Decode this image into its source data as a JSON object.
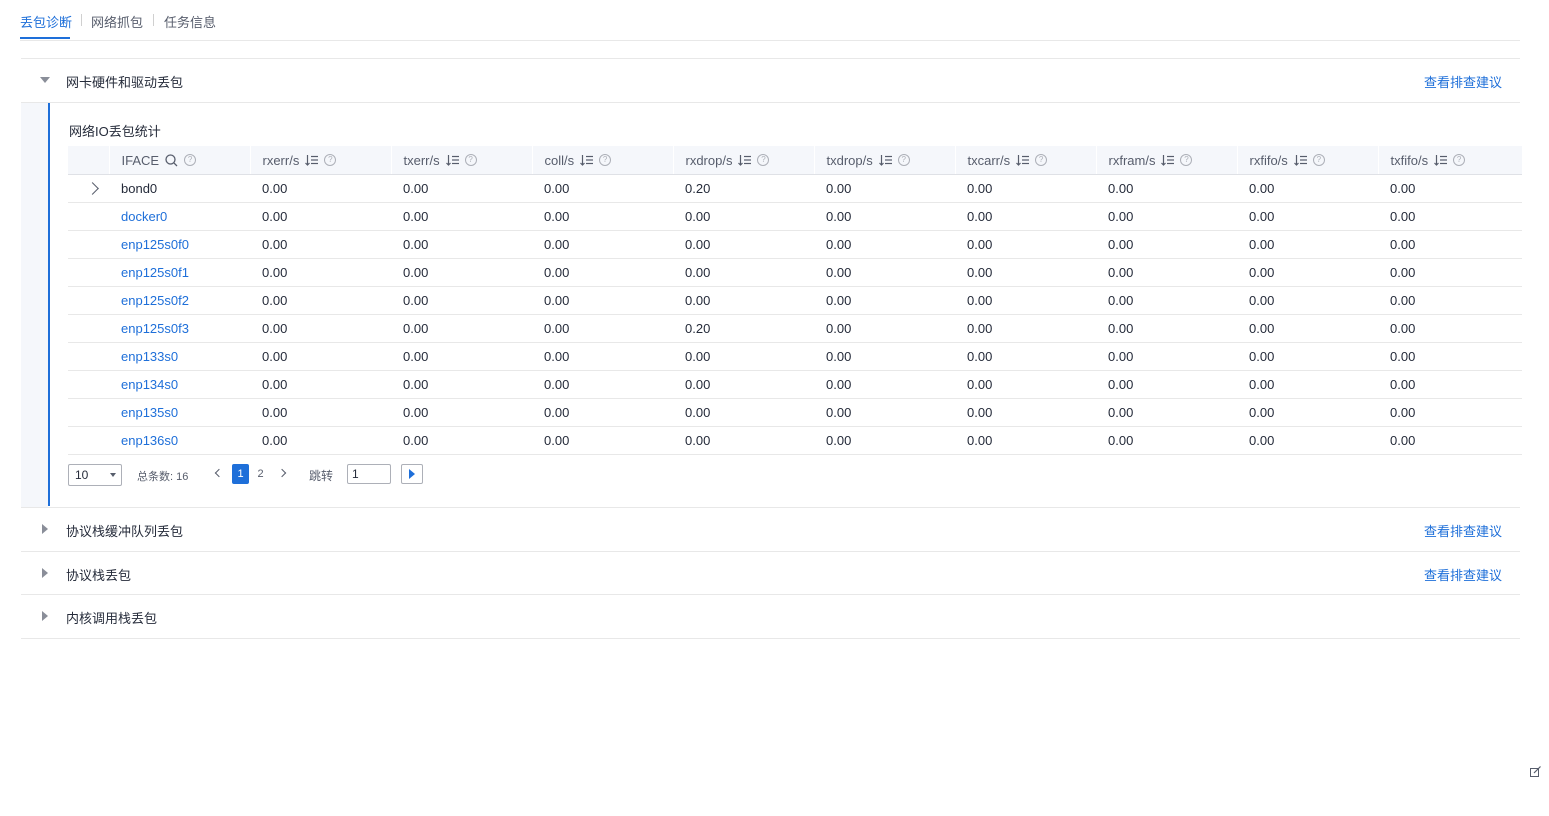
{
  "tabs": [
    {
      "label": "丢包诊断",
      "active": true
    },
    {
      "label": "网络抓包",
      "active": false
    },
    {
      "label": "任务信息",
      "active": false
    }
  ],
  "sections": [
    {
      "title": "网卡硬件和驱动丢包",
      "advice": "查看排查建议",
      "expanded": true
    },
    {
      "title": "协议栈缓冲队列丢包",
      "advice": "查看排查建议",
      "expanded": false
    },
    {
      "title": "协议栈丢包",
      "advice": "查看排查建议",
      "expanded": false
    },
    {
      "title": "内核调用栈丢包",
      "advice": "",
      "expanded": false
    }
  ],
  "table": {
    "title": "网络IO丢包统计",
    "columns": [
      "IFACE",
      "rxerr/s",
      "txerr/s",
      "coll/s",
      "rxdrop/s",
      "txdrop/s",
      "txcarr/s",
      "rxfram/s",
      "rxfifo/s",
      "txfifo/s"
    ],
    "rows": [
      {
        "iface": "bond0",
        "expandable": true,
        "values": [
          "0.00",
          "0.00",
          "0.00",
          "0.20",
          "0.00",
          "0.00",
          "0.00",
          "0.00",
          "0.00"
        ]
      },
      {
        "iface": "docker0",
        "values": [
          "0.00",
          "0.00",
          "0.00",
          "0.00",
          "0.00",
          "0.00",
          "0.00",
          "0.00",
          "0.00"
        ]
      },
      {
        "iface": "enp125s0f0",
        "values": [
          "0.00",
          "0.00",
          "0.00",
          "0.00",
          "0.00",
          "0.00",
          "0.00",
          "0.00",
          "0.00"
        ]
      },
      {
        "iface": "enp125s0f1",
        "values": [
          "0.00",
          "0.00",
          "0.00",
          "0.00",
          "0.00",
          "0.00",
          "0.00",
          "0.00",
          "0.00"
        ]
      },
      {
        "iface": "enp125s0f2",
        "values": [
          "0.00",
          "0.00",
          "0.00",
          "0.00",
          "0.00",
          "0.00",
          "0.00",
          "0.00",
          "0.00"
        ]
      },
      {
        "iface": "enp125s0f3",
        "values": [
          "0.00",
          "0.00",
          "0.00",
          "0.20",
          "0.00",
          "0.00",
          "0.00",
          "0.00",
          "0.00"
        ]
      },
      {
        "iface": "enp133s0",
        "values": [
          "0.00",
          "0.00",
          "0.00",
          "0.00",
          "0.00",
          "0.00",
          "0.00",
          "0.00",
          "0.00"
        ]
      },
      {
        "iface": "enp134s0",
        "values": [
          "0.00",
          "0.00",
          "0.00",
          "0.00",
          "0.00",
          "0.00",
          "0.00",
          "0.00",
          "0.00"
        ]
      },
      {
        "iface": "enp135s0",
        "values": [
          "0.00",
          "0.00",
          "0.00",
          "0.00",
          "0.00",
          "0.00",
          "0.00",
          "0.00",
          "0.00"
        ]
      },
      {
        "iface": "enp136s0",
        "values": [
          "0.00",
          "0.00",
          "0.00",
          "0.00",
          "0.00",
          "0.00",
          "0.00",
          "0.00",
          "0.00"
        ]
      }
    ]
  },
  "pager": {
    "page_size": "10",
    "total_label": "总条数:",
    "total": "16",
    "pages": [
      "1",
      "2"
    ],
    "current_page": "1",
    "jump_label": "跳转",
    "jump_value": "1"
  },
  "colors": {
    "accent": "#1e6fd9",
    "text": "#252b3a",
    "muted": "#575d6c"
  }
}
